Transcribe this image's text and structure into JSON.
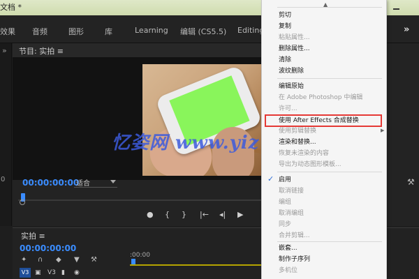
{
  "title_bar": {
    "title": "文档 *"
  },
  "workspaces": {
    "items": [
      "效果",
      "音频",
      "图形",
      "库",
      "Learning",
      "编辑 (CS5.5)",
      "Editing"
    ],
    "more": "»"
  },
  "left_panel": {
    "chevron": "»",
    "number": "0"
  },
  "program_monitor": {
    "title": "节目: 实拍 ≡",
    "timecode": "00:00:00:00",
    "fit_select": "适合"
  },
  "transport": {
    "labels": [
      "●",
      "{",
      "}",
      "|←",
      "◂|",
      "▶"
    ]
  },
  "timeline": {
    "title": "实拍 ≡",
    "timecode": "00:00:00:00",
    "ruler_label": ":00:00",
    "track": "V3"
  },
  "context_menu": {
    "items": [
      {
        "label": "剪切",
        "enabled": true
      },
      {
        "label": "复制",
        "enabled": true
      },
      {
        "label": "粘贴属性...",
        "enabled": false
      },
      {
        "label": "删除属性...",
        "enabled": true
      },
      {
        "label": "清除",
        "enabled": true
      },
      {
        "label": "波纹删除",
        "enabled": true
      },
      {
        "label": "编辑原始",
        "enabled": true
      },
      {
        "label": "在 Adobe Photoshop 中编辑",
        "enabled": false
      },
      {
        "label": "许可...",
        "enabled": false
      },
      {
        "label": "使用 After Effects 合成替换",
        "enabled": true
      },
      {
        "label": "使用剪辑替换",
        "enabled": false
      },
      {
        "label": "渲染和替换...",
        "enabled": true
      },
      {
        "label": "恢复未渲染的内容",
        "enabled": false
      },
      {
        "label": "导出为动态图形模板...",
        "enabled": false
      },
      {
        "label": "启用",
        "enabled": true
      },
      {
        "label": "取消链接",
        "enabled": false
      },
      {
        "label": "编组",
        "enabled": false
      },
      {
        "label": "取消编组",
        "enabled": false
      },
      {
        "label": "同步",
        "enabled": false
      },
      {
        "label": "合并剪辑...",
        "enabled": false
      },
      {
        "label": "嵌套...",
        "enabled": true
      },
      {
        "label": "制作子序列",
        "enabled": true
      },
      {
        "label": "多机位",
        "enabled": false
      }
    ],
    "checked_item": "启用",
    "highlighted_item": "使用 After Effects 合成替换"
  },
  "watermark": "忆姿网 www.yiz"
}
